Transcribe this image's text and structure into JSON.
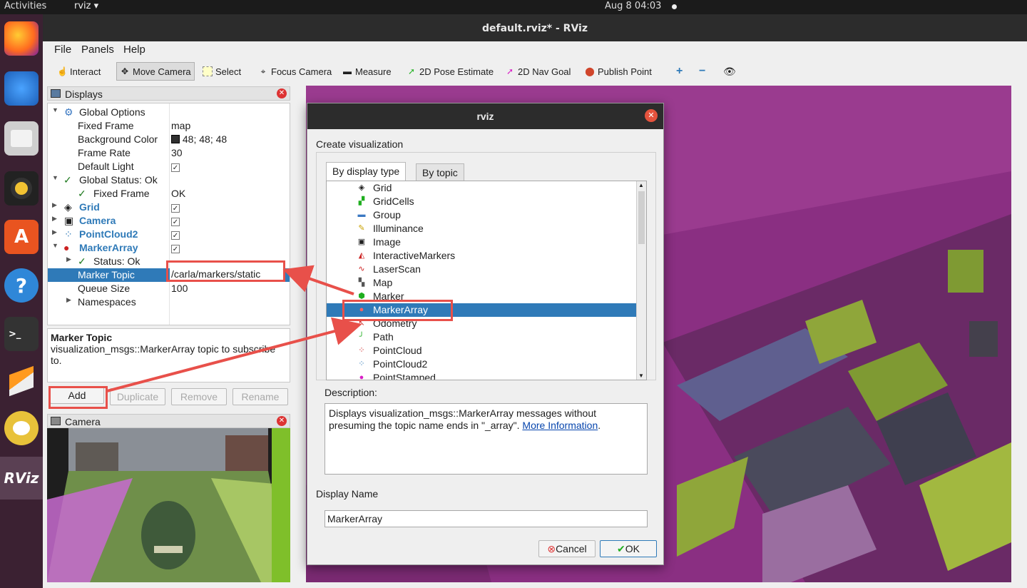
{
  "topbar": {
    "activities": "Activities",
    "app": "rviz ▾",
    "clock": "Aug 8  04:03"
  },
  "dock": {
    "items": [
      "firefox-icon",
      "thunderbird-icon",
      "files-icon",
      "rhythmbox-icon",
      "software-icon",
      "help-icon",
      "terminal-icon",
      "sublime-icon",
      "carla-icon",
      "rviz-icon"
    ],
    "rviz_label": "RViz"
  },
  "window": {
    "title": "default.rviz* - RViz"
  },
  "menu": {
    "file": "File",
    "panels": "Panels",
    "help": "Help"
  },
  "toolbar": {
    "interact": "Interact",
    "move_camera": "Move Camera",
    "select": "Select",
    "focus_camera": "Focus Camera",
    "measure": "Measure",
    "pose_estimate": "2D Pose Estimate",
    "nav_goal": "2D Nav Goal",
    "publish_point": "Publish Point",
    "plus": "+",
    "minus": "−",
    "eye": "👁"
  },
  "displays": {
    "title": "Displays",
    "rows": [
      {
        "k": "Global Options"
      },
      {
        "k": "Fixed Frame",
        "v": "map"
      },
      {
        "k": "Background Color",
        "v": "48; 48; 48"
      },
      {
        "k": "Frame Rate",
        "v": "30"
      },
      {
        "k": "Default Light",
        "v": "✓"
      },
      {
        "k": "Global Status: Ok"
      },
      {
        "k": "Fixed Frame",
        "v": "OK"
      },
      {
        "k": "Grid",
        "v": "✓"
      },
      {
        "k": "Camera",
        "v": "✓"
      },
      {
        "k": "PointCloud2",
        "v": "✓"
      },
      {
        "k": "MarkerArray",
        "v": "✓"
      },
      {
        "k": "Status: Ok"
      },
      {
        "k": "Marker Topic",
        "v": "/carla/markers/static"
      },
      {
        "k": "Queue Size",
        "v": "100"
      },
      {
        "k": "Namespaces"
      }
    ]
  },
  "description": {
    "title": "Marker Topic",
    "text": "visualization_msgs::MarkerArray topic to subscribe to."
  },
  "buttons": {
    "add": "Add",
    "duplicate": "Duplicate",
    "remove": "Remove",
    "rename": "Rename"
  },
  "camera": {
    "title": "Camera"
  },
  "dialog": {
    "title": "rviz",
    "header": "Create visualization",
    "tab_type": "By display type",
    "tab_topic": "By topic",
    "items": [
      "Grid",
      "GridCells",
      "Group",
      "Illuminance",
      "Image",
      "InteractiveMarkers",
      "LaserScan",
      "Map",
      "Marker",
      "MarkerArray",
      "Odometry",
      "Path",
      "PointCloud",
      "PointCloud2",
      "PointStamped"
    ],
    "selected": "MarkerArray",
    "desc_label": "Description:",
    "desc_text": "Displays visualization_msgs::MarkerArray messages without presuming the topic name ends in \"_array\".",
    "desc_link": "More Information",
    "desc_end": ".",
    "name_label": "Display Name",
    "name_value": "MarkerArray",
    "cancel": "Cancel",
    "ok": "OK"
  },
  "colors": {
    "accent": "#2f7ab8",
    "highlight": "#e8504a",
    "scene": "#8a2f82"
  }
}
